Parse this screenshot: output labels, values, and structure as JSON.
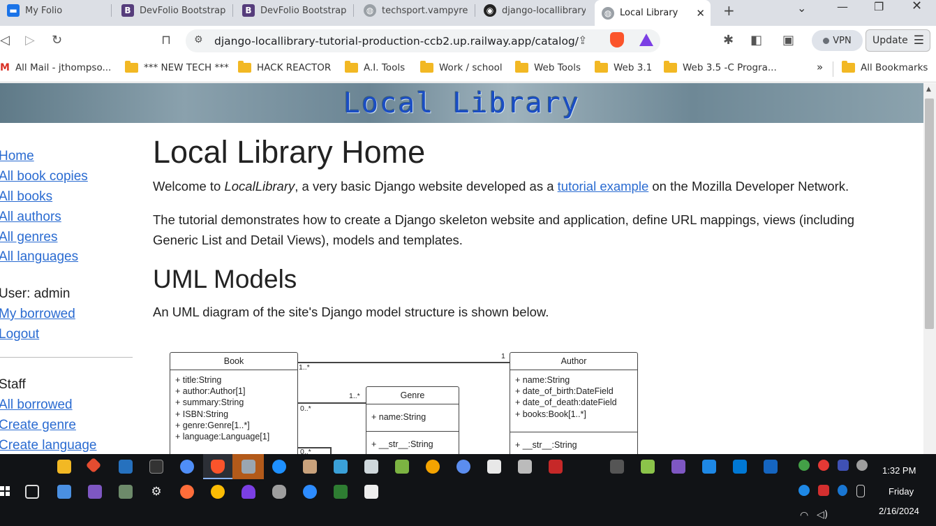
{
  "browser": {
    "tabs": [
      {
        "label": "My Folio",
        "icon": "folio-icon",
        "color": "#1a73e8"
      },
      {
        "label": "DevFolio Bootstrap",
        "icon": "bootstrap-icon",
        "color": "#563d7c"
      },
      {
        "label": "DevFolio Bootstrap",
        "icon": "bootstrap-icon",
        "color": "#563d7c"
      },
      {
        "label": "techsport.vampyre",
        "icon": "globe-icon",
        "color": "#888888"
      },
      {
        "label": "django-locallibrary",
        "icon": "github-icon",
        "color": "#222222"
      },
      {
        "label": "Local Library",
        "icon": "globe-icon",
        "color": "#888888",
        "active": true
      }
    ],
    "new_tab_glyph": "+",
    "address": "django-locallibrary-tutorial-production-ccb2.up.railway.app/catalog/",
    "vpn_label": "VPN",
    "update_label": "Update",
    "bookmarks": [
      {
        "label": "All Mail - jthompso...",
        "icon": "gmail-icon"
      },
      {
        "label": "*** NEW TECH ***",
        "icon": "folder-icon"
      },
      {
        "label": "HACK REACTOR",
        "icon": "folder-icon"
      },
      {
        "label": "A.I. Tools",
        "icon": "folder-icon"
      },
      {
        "label": "Work / school",
        "icon": "folder-icon"
      },
      {
        "label": "Web Tools",
        "icon": "folder-icon"
      },
      {
        "label": "Web 3.1",
        "icon": "folder-icon"
      },
      {
        "label": "Web 3.5  -C Progra...",
        "icon": "folder-icon"
      }
    ],
    "bookmarks_more": "»",
    "all_bookmarks": "All Bookmarks"
  },
  "page": {
    "banner_title": "Local Library",
    "sidebar": {
      "links": [
        "Home",
        "All book copies",
        "All books",
        "All authors",
        "All genres",
        "All languages"
      ],
      "user_label": "User: admin",
      "user_links": [
        "My borrowed",
        "Logout"
      ],
      "staff_label": "Staff",
      "staff_links": [
        "All borrowed",
        "Create genre",
        "Create language"
      ]
    },
    "main": {
      "title": "Local Library Home",
      "welcome_pre": "Welcome to ",
      "welcome_em": "LocalLibrary",
      "welcome_mid": ", a very basic Django website developed as a ",
      "welcome_link": "tutorial example",
      "welcome_post": " on the Mozilla Developer Network.",
      "tutorial_text": "The tutorial demonstrates how to create a Django skeleton website and application, define URL mappings, views (including Generic List and Detail Views), models and templates.",
      "uml_heading": "UML Models",
      "uml_text": "An UML diagram of the site's Django model structure is shown below."
    },
    "uml": {
      "book": {
        "name": "Book",
        "attrs": [
          "+ title:String",
          "+ author:Author[1]",
          "+ summary:String",
          "+ ISBN:String",
          "+ genre:Genre[1..*]",
          "+ language:Language[1]"
        ]
      },
      "genre": {
        "name": "Genre",
        "attrs": [
          "+ name:String"
        ],
        "methods": [
          "+ __str__:String"
        ]
      },
      "author": {
        "name": "Author",
        "attrs": [
          "+ name:String",
          "+ date_of_birth:DateField",
          "+ date_of_death:dateField",
          "+ books:Book[1..*]"
        ],
        "methods": [
          "+ __str__:String"
        ]
      },
      "multiplicities": {
        "book_author_book": "1..*",
        "book_author_author": "1",
        "book_genre_book": "0..*",
        "book_genre_genre": "1..*",
        "book_language": "0..*"
      }
    }
  },
  "taskbar": {
    "time": "1:32 PM",
    "day": "Friday",
    "date": "2/16/2024"
  }
}
